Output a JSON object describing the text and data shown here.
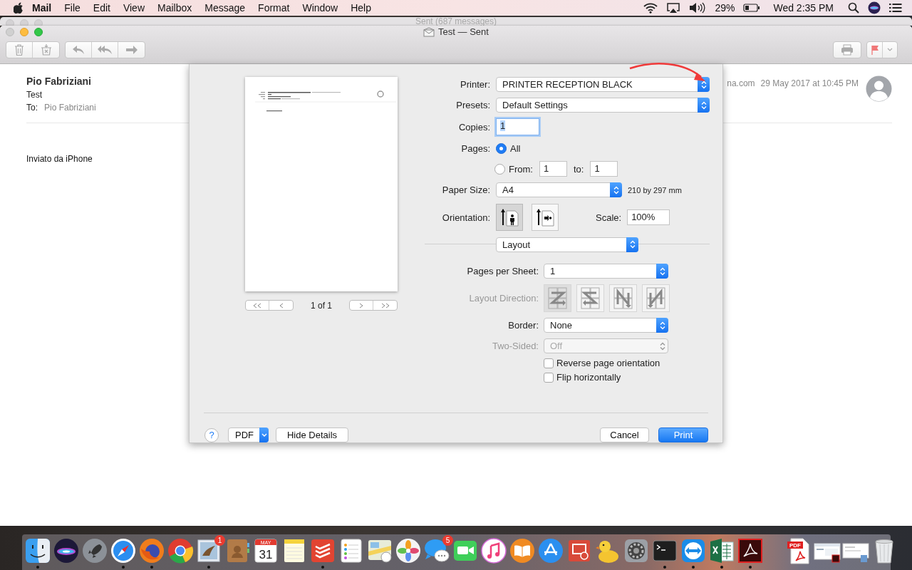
{
  "menu_bar": {
    "app_name": "Mail",
    "menus": [
      "File",
      "Edit",
      "View",
      "Mailbox",
      "Message",
      "Format",
      "Window",
      "Help"
    ],
    "battery": "29%",
    "clock": "Wed 2:35 PM"
  },
  "back_window": {
    "title": "Sent (687 messages)"
  },
  "window": {
    "title": "Test — Sent"
  },
  "message": {
    "sender": "Pio Fabriziani",
    "subject": "Test",
    "to_label": "To:",
    "to": "Pio Fabriziani",
    "address_fragment": "na.com",
    "date": "29 May 2017 at 10:45 PM",
    "body": "Inviato da iPhone"
  },
  "print_dialog": {
    "preview": {
      "page_counter": "1 of 1"
    },
    "printer": {
      "label": "Printer:",
      "value": "PRINTER RECEPTION BLACK"
    },
    "presets": {
      "label": "Presets:",
      "value": "Default Settings"
    },
    "copies": {
      "label": "Copies:",
      "value": "1"
    },
    "pages": {
      "label": "Pages:",
      "options": [
        {
          "label": "All",
          "selected": true
        },
        {
          "label": "From:",
          "selected": false
        }
      ],
      "from": "1",
      "to_label": "to:",
      "to": "1"
    },
    "paper_size": {
      "label": "Paper Size:",
      "value": "A4",
      "dimensions": "210 by 297 mm"
    },
    "orientation": {
      "label": "Orientation:",
      "options": [
        {
          "kind": "portrait",
          "selected": true
        },
        {
          "kind": "landscape",
          "selected": false
        }
      ]
    },
    "scale": {
      "label": "Scale:",
      "value": "100%"
    },
    "section": {
      "value": "Layout"
    },
    "pages_per_sheet": {
      "label": "Pages per Sheet:",
      "value": "1"
    },
    "layout_direction": {
      "label": "Layout Direction:",
      "disabled": true,
      "options": [
        {
          "kind": "z",
          "selected": true
        },
        {
          "kind": "s",
          "selected": false
        },
        {
          "kind": "n_reversed",
          "selected": false
        },
        {
          "kind": "n",
          "selected": false
        }
      ]
    },
    "border": {
      "label": "Border:",
      "value": "None"
    },
    "two_sided": {
      "label": "Two-Sided:",
      "value": "Off",
      "disabled": true
    },
    "checkboxes": [
      {
        "label": "Reverse page orientation",
        "checked": false
      },
      {
        "label": "Flip horizontally",
        "checked": false
      }
    ],
    "buttons": {
      "help": "?",
      "pdf": "PDF",
      "hide_details": "Hide Details",
      "cancel": "Cancel",
      "print": "Print"
    }
  },
  "dock": {
    "apps": [
      {
        "kind": "finder",
        "running": true
      },
      {
        "kind": "siri",
        "running": false
      },
      {
        "kind": "launchpad",
        "running": false
      },
      {
        "kind": "safari",
        "running": true
      },
      {
        "kind": "firefox",
        "running": true
      },
      {
        "kind": "chrome",
        "running": false
      },
      {
        "kind": "mail",
        "running": true,
        "badge": "1"
      },
      {
        "kind": "contacts",
        "running": false
      },
      {
        "kind": "calendar",
        "running": false,
        "month": "MAY",
        "day": "31"
      },
      {
        "kind": "notes",
        "running": false
      },
      {
        "kind": "todoist",
        "running": true
      },
      {
        "kind": "reminders",
        "running": false
      },
      {
        "kind": "maps",
        "running": false
      },
      {
        "kind": "photos",
        "running": false
      },
      {
        "kind": "messages",
        "running": false,
        "badge": "5"
      },
      {
        "kind": "facetime",
        "running": false
      },
      {
        "kind": "itunes",
        "running": false
      },
      {
        "kind": "ibooks",
        "running": false
      },
      {
        "kind": "appstore",
        "running": false
      },
      {
        "kind": "remote",
        "running": false
      },
      {
        "kind": "duck",
        "running": false
      },
      {
        "kind": "preferences",
        "running": false
      },
      {
        "kind": "terminal",
        "running": true
      },
      {
        "kind": "teamviewer",
        "running": true
      },
      {
        "kind": "excel",
        "running": true
      },
      {
        "kind": "acrobat",
        "running": true
      }
    ],
    "documents": [
      {
        "kind": "pdf_file",
        "label": "PDF"
      },
      {
        "kind": "window_thumb"
      },
      {
        "kind": "window_thumb_preview"
      },
      {
        "kind": "trash"
      }
    ]
  }
}
